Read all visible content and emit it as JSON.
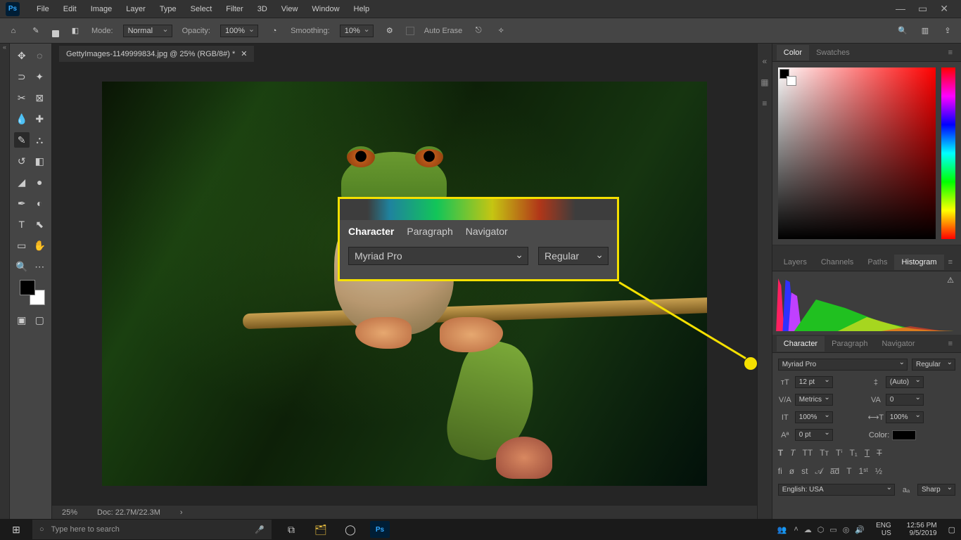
{
  "menu": {
    "items": [
      "File",
      "Edit",
      "Image",
      "Layer",
      "Type",
      "Select",
      "Filter",
      "3D",
      "View",
      "Window",
      "Help"
    ]
  },
  "options_bar": {
    "mode_label": "Mode:",
    "mode_value": "Normal",
    "opacity_label": "Opacity:",
    "opacity_value": "100%",
    "smoothing_label": "Smoothing:",
    "smoothing_value": "10%",
    "auto_erase_label": "Auto Erase"
  },
  "document": {
    "tab_title": "GettyImages-1149999834.jpg @ 25% (RGB/8#) *",
    "zoom": "25%",
    "doc_size": "Doc: 22.7M/22.3M"
  },
  "panels": {
    "color_tabs": [
      "Color",
      "Swatches"
    ],
    "hist_tabs": [
      "Layers",
      "Channels",
      "Paths",
      "Histogram"
    ],
    "char_tabs": [
      "Character",
      "Paragraph",
      "Navigator"
    ]
  },
  "character": {
    "font": "Myriad Pro",
    "style": "Regular",
    "size": "12 pt",
    "leading": "(Auto)",
    "kerning": "Metrics",
    "tracking": "0",
    "v_scale": "100%",
    "h_scale": "100%",
    "baseline": "0 pt",
    "color_label": "Color:",
    "language": "English: USA",
    "aa": "Sharp"
  },
  "callout": {
    "tabs": [
      "Character",
      "Paragraph",
      "Navigator"
    ],
    "font": "Myriad Pro",
    "style": "Regular"
  },
  "taskbar": {
    "search_placeholder": "Type here to search",
    "lang1": "ENG",
    "lang2": "US",
    "time": "12:56 PM",
    "date": "9/5/2019"
  }
}
